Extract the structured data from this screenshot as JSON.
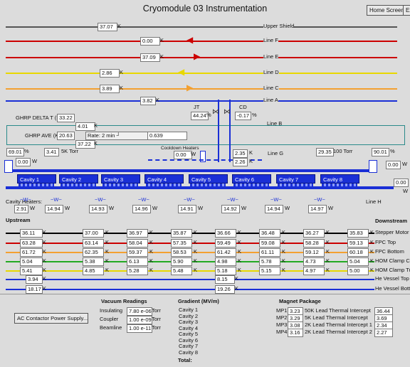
{
  "window": {
    "title": "Cryomodule 03 Instrumentation"
  },
  "toolbar": {
    "home": "Home Screen...",
    "exit": "Ex"
  },
  "lines": [
    {
      "value": "37.07",
      "unit": "K",
      "name": "Upper Shield",
      "color": "#555555"
    },
    {
      "value": "0.00",
      "unit": "K",
      "name": "Line F",
      "color": "#cc0000"
    },
    {
      "value": "37.09",
      "unit": "K",
      "name": "Line E",
      "color": "#cc0000"
    },
    {
      "value": "2.86",
      "unit": "K",
      "name": "Line D",
      "color": "#e8d800"
    },
    {
      "value": "3.89",
      "unit": "K",
      "name": "Line C",
      "color": "#f3a030"
    },
    {
      "value": "3.82",
      "unit": "K",
      "name": "Line A",
      "color": "#1a2fd6"
    }
  ],
  "ghrp": {
    "delta_label": "GHRP DELTA T (K)",
    "delta_value": "33.22",
    "ave_label": "GHRP AVE (K)",
    "ave_value": "20.63",
    "upper_temp": "4.01",
    "lower_temp": "37.22",
    "unit": "K",
    "rate_label": "Rate: 2 min",
    "rate_value": "0.639"
  },
  "valves": {
    "jt_label": "JT",
    "jt_value": "44.24",
    "cd_label": "CD",
    "cd_value": "-0.17",
    "unit": "%"
  },
  "line_b": "Line B",
  "cooldown": {
    "label": "Cooldown Heaters",
    "value": "0.00",
    "unit": "W"
  },
  "line_g": {
    "t1": "2.35",
    "t2": "2.26",
    "unit": "K",
    "name": "Line G"
  },
  "pressure_left": {
    "pct": "69.01",
    "pct_unit": "%",
    "temp": "3.41",
    "torr": "5K Torr",
    "heater": "0.00",
    "w": "W"
  },
  "pressure_right": {
    "torr_value": "29.35",
    "torr_label": "100 Torr",
    "pct": "90.01",
    "pct_unit": "%",
    "heater1": "0.00",
    "heater2": "0.00",
    "w": "W"
  },
  "cavities": [
    "Cavity 1",
    "Cavity 2",
    "Cavity 3",
    "Cavity 4",
    "Cavity 5",
    "Cavity 6",
    "Cavity 7",
    "Cavity 8"
  ],
  "cavity_heaters": {
    "label": "Cavity Heaters:",
    "unit": "W",
    "values": [
      "2.91",
      "14.94",
      "14.93",
      "14.96",
      "14.91",
      "14.92",
      "14.94",
      "14.97"
    ],
    "line_h": "Line H"
  },
  "upstream": "Upstream",
  "downstream": "Downstream",
  "sensor_rows": [
    {
      "name": "Stepper Motor",
      "color": "#000000",
      "values": [
        "36.11",
        "37.00",
        "36.97",
        "35.87",
        "36.66",
        "36.48",
        "36.27",
        "35.83"
      ]
    },
    {
      "name": "FPC Top",
      "color": "#cc0000",
      "values": [
        "63.28",
        "63.14",
        "58.04",
        "57.35",
        "59.49",
        "59.08",
        "58.28",
        "59.13"
      ]
    },
    {
      "name": "FPC Bottom",
      "color": "#f3a030",
      "values": [
        "61.72",
        "62.35",
        "59.37",
        "58.53",
        "61.42",
        "61.11",
        "59.12",
        "60.18"
      ]
    },
    {
      "name": "HOM Clamp Cou",
      "color": "#22aa22",
      "values": [
        "5.04",
        "5.38",
        "6.13",
        "5.90",
        "4.98",
        "5.78",
        "4.73",
        "5.04"
      ]
    },
    {
      "name": "HOM Clamp Tun",
      "color": "#e8d800",
      "values": [
        "5.41",
        "4.85",
        "5.28",
        "5.48",
        "5.18",
        "5.15",
        "4.97",
        "5.00"
      ]
    }
  ],
  "vessel_top": {
    "name": "He Vessel Top",
    "up": "3.94",
    "mid": "8.15"
  },
  "vessel_bottom": {
    "name": "He Vessel Botto",
    "up": "18.17",
    "mid": "19.26"
  },
  "temp_unit": "K",
  "ac_button": "AC Contactor Power Supply...",
  "vacuum": {
    "title": "Vacuum Readings",
    "rows": [
      {
        "label": "Insulating",
        "value": "7.80 e-06",
        "unit": "Torr"
      },
      {
        "label": "Coupler",
        "value": "1.00 e-09",
        "unit": "Torr"
      },
      {
        "label": "Beamline",
        "value": "1.00 e-11",
        "unit": "Torr"
      }
    ]
  },
  "gradient": {
    "title": "Gradient (MV/m)",
    "cavities": [
      "Cavity 1",
      "Cavity 2",
      "Cavity 3",
      "Cavity 4",
      "Cavity 5",
      "Cavity 6",
      "Cavity 7",
      "Cavity 8"
    ],
    "total": "Total:"
  },
  "magnet": {
    "title": "Magnet Package",
    "rows": [
      {
        "mp": "MP1",
        "v": "3.23",
        "label": "50K Lead Thermal Intercept",
        "val": "36.44"
      },
      {
        "mp": "MP2",
        "v": "3.29",
        "label": "5K Lead Thermal Intercept",
        "val": "3.69"
      },
      {
        "mp": "MP3",
        "v": "3.08",
        "label": "2K Lead Thermal Intercept 1",
        "val": "2.34"
      },
      {
        "mp": "MP4",
        "v": "3.16",
        "label": "2K Lead Thermal Intercept 2",
        "val": "2.27"
      }
    ]
  }
}
